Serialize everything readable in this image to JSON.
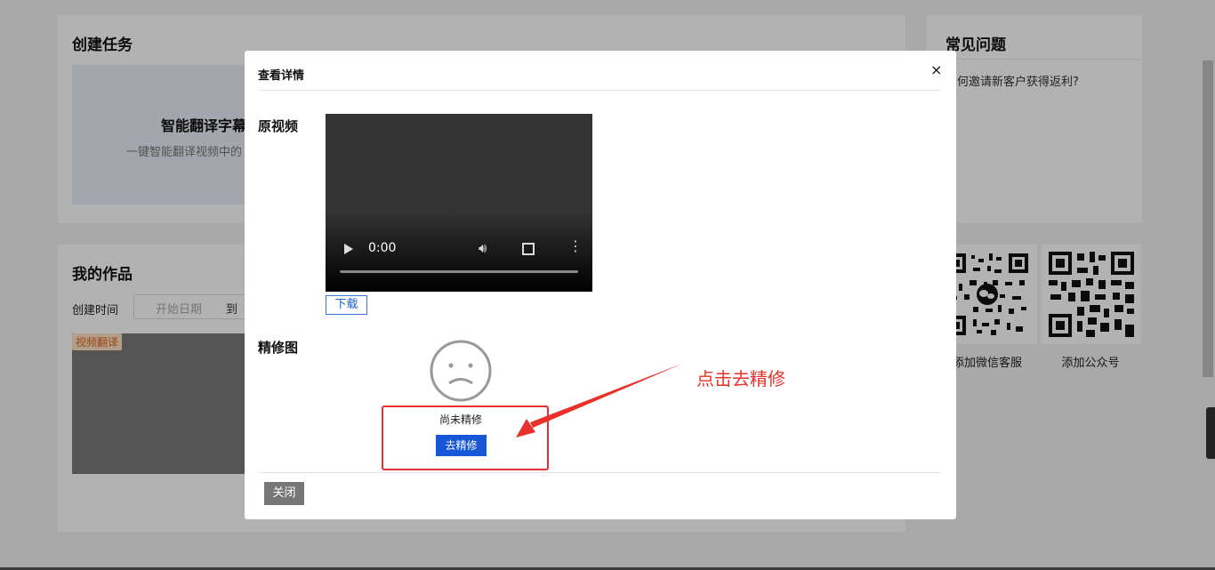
{
  "create_task": {
    "title": "创建任务",
    "tool_title": "智能翻译字幕",
    "tool_desc": "一键智能翻译视频中的"
  },
  "works": {
    "title": "我的作品",
    "create_time_label": "创建时间",
    "date_start_placeholder": "开始日期",
    "date_to": "到",
    "item_tag": "视频翻译"
  },
  "faq": {
    "title": "常见问题",
    "item": "如何邀请新客户获得返利?"
  },
  "qr": {
    "left_label": "添加微信客服",
    "right_label": "添加公众号"
  },
  "modal": {
    "title": "查看详情",
    "close_x": "×",
    "video_section_label": "原视频",
    "video_time": "0:00",
    "download_label": "下载",
    "refine_section_label": "精修图",
    "not_refined_text": "尚未精修",
    "go_refine_label": "去精修",
    "close_label": "关闭"
  },
  "annotation": {
    "text": "点击去精修",
    "color": "#e8312a"
  },
  "colors": {
    "primary_blue": "#1657d8",
    "overlay": "rgba(0,0,0,0.3)"
  }
}
